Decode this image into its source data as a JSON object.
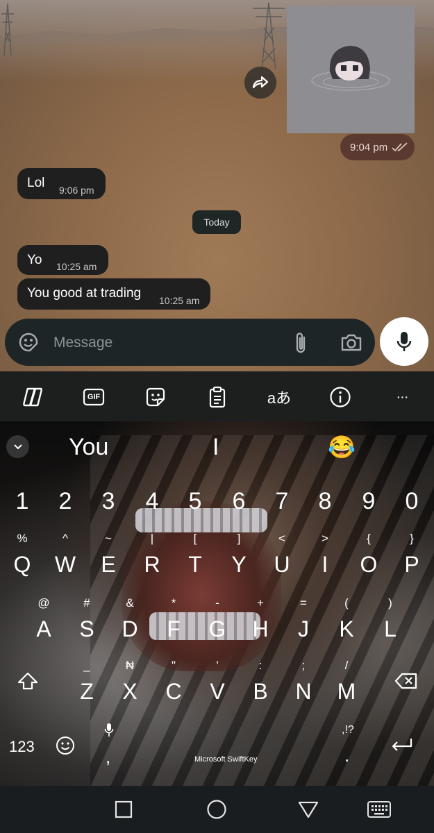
{
  "chat": {
    "outgoing_time": "9:04 pm",
    "messages": [
      {
        "text": "Lol",
        "time": "9:06 pm"
      },
      {
        "text": "Yo",
        "time": "10:25 am"
      },
      {
        "text": "You good at trading",
        "time": "10:25 am"
      }
    ],
    "day_divider": "Today"
  },
  "composer": {
    "placeholder": "Message",
    "icons": [
      "sticker-icon",
      "paperclip-icon",
      "camera-icon",
      "microphone-icon"
    ]
  },
  "toolbar": {
    "gif_label": "GIF",
    "translate_label": "aあ",
    "more_label": "···"
  },
  "keyboard": {
    "brand": "Microsoft SwiftKey",
    "suggestions": [
      "You",
      "I",
      "😂"
    ],
    "numbers": [
      "1",
      "2",
      "3",
      "4",
      "5",
      "6",
      "7",
      "8",
      "9",
      "0"
    ],
    "row1": [
      {
        "key": "Q",
        "hint": "%"
      },
      {
        "key": "W",
        "hint": "^"
      },
      {
        "key": "E",
        "hint": "~"
      },
      {
        "key": "R",
        "hint": "|"
      },
      {
        "key": "T",
        "hint": "["
      },
      {
        "key": "Y",
        "hint": "]"
      },
      {
        "key": "U",
        "hint": "<"
      },
      {
        "key": "I",
        "hint": ">"
      },
      {
        "key": "O",
        "hint": "{"
      },
      {
        "key": "P",
        "hint": "}"
      }
    ],
    "row2": [
      {
        "key": "A",
        "hint": "@"
      },
      {
        "key": "S",
        "hint": "#"
      },
      {
        "key": "D",
        "hint": "&"
      },
      {
        "key": "F",
        "hint": "*"
      },
      {
        "key": "G",
        "hint": "-"
      },
      {
        "key": "H",
        "hint": "+"
      },
      {
        "key": "J",
        "hint": "="
      },
      {
        "key": "K",
        "hint": "("
      },
      {
        "key": "L",
        "hint": ")"
      }
    ],
    "row3": [
      {
        "key": "Z",
        "hint": "_"
      },
      {
        "key": "X",
        "hint": "₦"
      },
      {
        "key": "C",
        "hint": "\""
      },
      {
        "key": "V",
        "hint": "'"
      },
      {
        "key": "B",
        "hint": ":"
      },
      {
        "key": "N",
        "hint": ";"
      },
      {
        "key": "M",
        "hint": "/"
      }
    ],
    "symbols_label": "123",
    "comma_label": ",",
    "period_label": ".",
    "punct_hint": ",!?"
  }
}
